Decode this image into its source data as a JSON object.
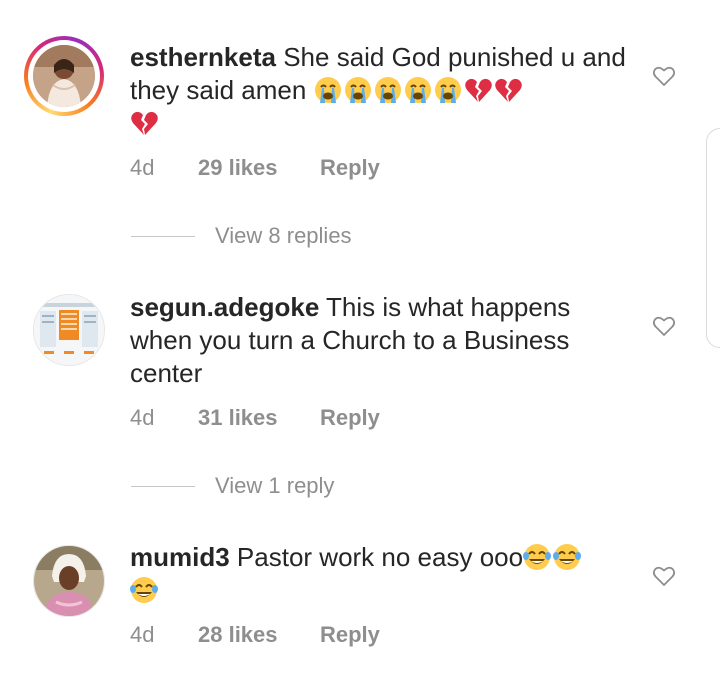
{
  "comments": [
    {
      "username": "esthernketa",
      "text": "She said God punished u and they said amen",
      "emojis": [
        "loudly-crying-face",
        "loudly-crying-face",
        "loudly-crying-face",
        "loudly-crying-face",
        "loudly-crying-face",
        "broken-heart",
        "broken-heart",
        "broken-heart"
      ],
      "time": "4d",
      "likes": "29 likes",
      "reply_label": "Reply",
      "view_replies": "View 8 replies",
      "has_story_ring": true
    },
    {
      "username": "segun.adegoke",
      "text": "This is what happens when you turn a Church to a Business center",
      "time": "4d",
      "likes": "31 likes",
      "reply_label": "Reply",
      "view_replies": "View 1 reply",
      "has_story_ring": false
    },
    {
      "username": "mumid3",
      "text": "Pastor work no easy ooo",
      "emojis": [
        "face-with-tears-of-joy",
        "face-with-tears-of-joy",
        "face-with-tears-of-joy"
      ],
      "time": "4d",
      "likes": "28 likes",
      "reply_label": "Reply",
      "has_story_ring": false
    }
  ],
  "icons": {
    "like": "heart-outline-icon"
  },
  "colors": {
    "text": "#262626",
    "secondary": "#8e8e8e",
    "crying_emoji": "#ffcc4d",
    "tears": "#5dadec",
    "broken_heart": "#dd2e44"
  }
}
